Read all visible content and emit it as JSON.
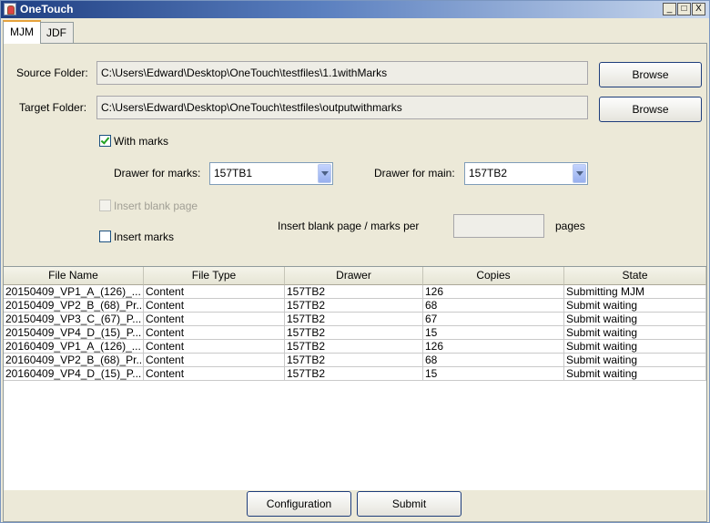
{
  "window": {
    "title": "OneTouch",
    "controls": [
      "_",
      "□",
      "X"
    ]
  },
  "tabs": [
    {
      "label": "MJM",
      "active": true
    },
    {
      "label": "JDF",
      "active": false
    }
  ],
  "source": {
    "label": "Source Folder:",
    "value": "C:\\Users\\Edward\\Desktop\\OneTouch\\testfiles\\1.1withMarks",
    "browse": "Browse"
  },
  "target": {
    "label": "Target Folder:",
    "value": "C:\\Users\\Edward\\Desktop\\OneTouch\\testfiles\\outputwithmarks",
    "browse": "Browse"
  },
  "with_marks": {
    "label": "With marks",
    "checked": true
  },
  "drawer_marks": {
    "label": "Drawer for marks:",
    "value": "157TB1"
  },
  "drawer_main": {
    "label": "Drawer for main:",
    "value": "157TB2"
  },
  "insert_blank": {
    "label": "Insert blank page",
    "checked": false,
    "disabled": true
  },
  "insert_marks": {
    "label": "Insert marks",
    "checked": false
  },
  "per": {
    "label": "Insert blank page / marks per",
    "value": "",
    "suffix": "pages"
  },
  "table": {
    "columns": [
      "File Name",
      "File Type",
      "Drawer",
      "Copies",
      "State"
    ],
    "rows": [
      [
        "20150409_VP1_A_(126)_...",
        "Content",
        "157TB2",
        "126",
        "Submitting MJM"
      ],
      [
        "20150409_VP2_B_(68)_Pr...",
        "Content",
        "157TB2",
        "68",
        "Submit waiting"
      ],
      [
        "20150409_VP3_C_(67)_P...",
        "Content",
        "157TB2",
        "67",
        "Submit waiting"
      ],
      [
        "20150409_VP4_D_(15)_P...",
        "Content",
        "157TB2",
        "15",
        "Submit waiting"
      ],
      [
        "20160409_VP1_A_(126)_...",
        "Content",
        "157TB2",
        "126",
        "Submit waiting"
      ],
      [
        "20160409_VP2_B_(68)_Pr...",
        "Content",
        "157TB2",
        "68",
        "Submit waiting"
      ],
      [
        "20160409_VP4_D_(15)_P...",
        "Content",
        "157TB2",
        "15",
        "Submit waiting"
      ]
    ]
  },
  "buttons": {
    "configuration": "Configuration",
    "submit": "Submit"
  }
}
